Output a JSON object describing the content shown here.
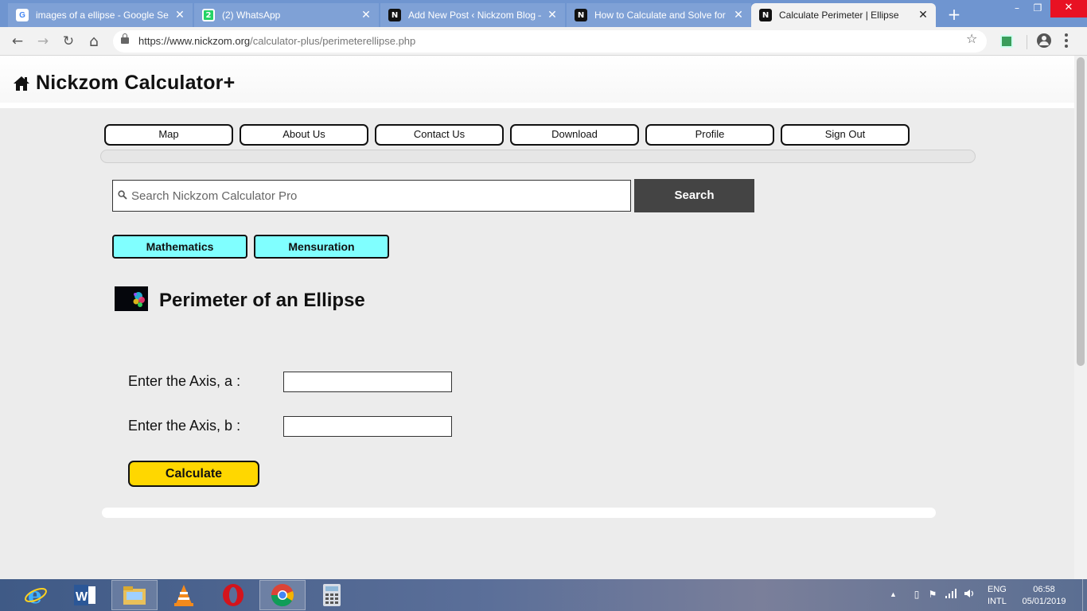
{
  "browser": {
    "tabs": [
      {
        "title": "images of a ellipse - Google Sea",
        "favicon": "google-icon",
        "active": false
      },
      {
        "title": "(2) WhatsApp",
        "favicon": "whatsapp-icon",
        "active": false
      },
      {
        "title": "Add New Post ‹ Nickzom Blog —",
        "favicon": "nickzom-icon",
        "active": false
      },
      {
        "title": "How to Calculate and Solve for t",
        "favicon": "nickzom-icon",
        "active": false
      },
      {
        "title": "Calculate Perimeter | Ellipse",
        "favicon": "nickzom-icon",
        "active": true
      }
    ],
    "close_glyph": "✕",
    "new_tab_glyph": "+",
    "url_host": "https://www.nickzom.org",
    "url_path": "/calculator-plus/perimeterellipse.php",
    "favicon_labels": {
      "google": "G",
      "whatsapp": "2",
      "nickzom": "N"
    },
    "window_controls": {
      "minimize": "–",
      "maximize": "❐",
      "close": "✕"
    },
    "nav_glyphs": {
      "back": "←",
      "forward": "→",
      "reload": "↻",
      "home": "⌂",
      "bookmark": "☆"
    }
  },
  "site": {
    "brand": "Nickzom Calculator+",
    "nav": [
      "Map",
      "About Us",
      "Contact Us",
      "Download",
      "Profile",
      "Sign Out"
    ],
    "search": {
      "placeholder": "Search Nickzom Calculator Pro",
      "value": "",
      "button": "Search"
    },
    "breadcrumbs": [
      "Mathematics",
      "Mensuration"
    ],
    "page_title": "Perimeter of an Ellipse",
    "form": {
      "label_a": "Enter the Axis, a :",
      "value_a": "",
      "label_b": "Enter the Axis, b :",
      "value_b": "",
      "submit": "Calculate"
    }
  },
  "taskbar": {
    "apps": [
      "internet-explorer-icon",
      "word-icon",
      "file-explorer-icon",
      "vlc-icon",
      "opera-icon",
      "chrome-icon",
      "calculator-icon"
    ],
    "language": [
      "ENG",
      "INTL"
    ],
    "time": "06:58",
    "date": "05/01/2019"
  },
  "colors": {
    "tabbar": "#6f95d0",
    "accent_cyan": "#80ffff",
    "calculate_yellow": "#ffd700",
    "search_button": "#444444"
  }
}
